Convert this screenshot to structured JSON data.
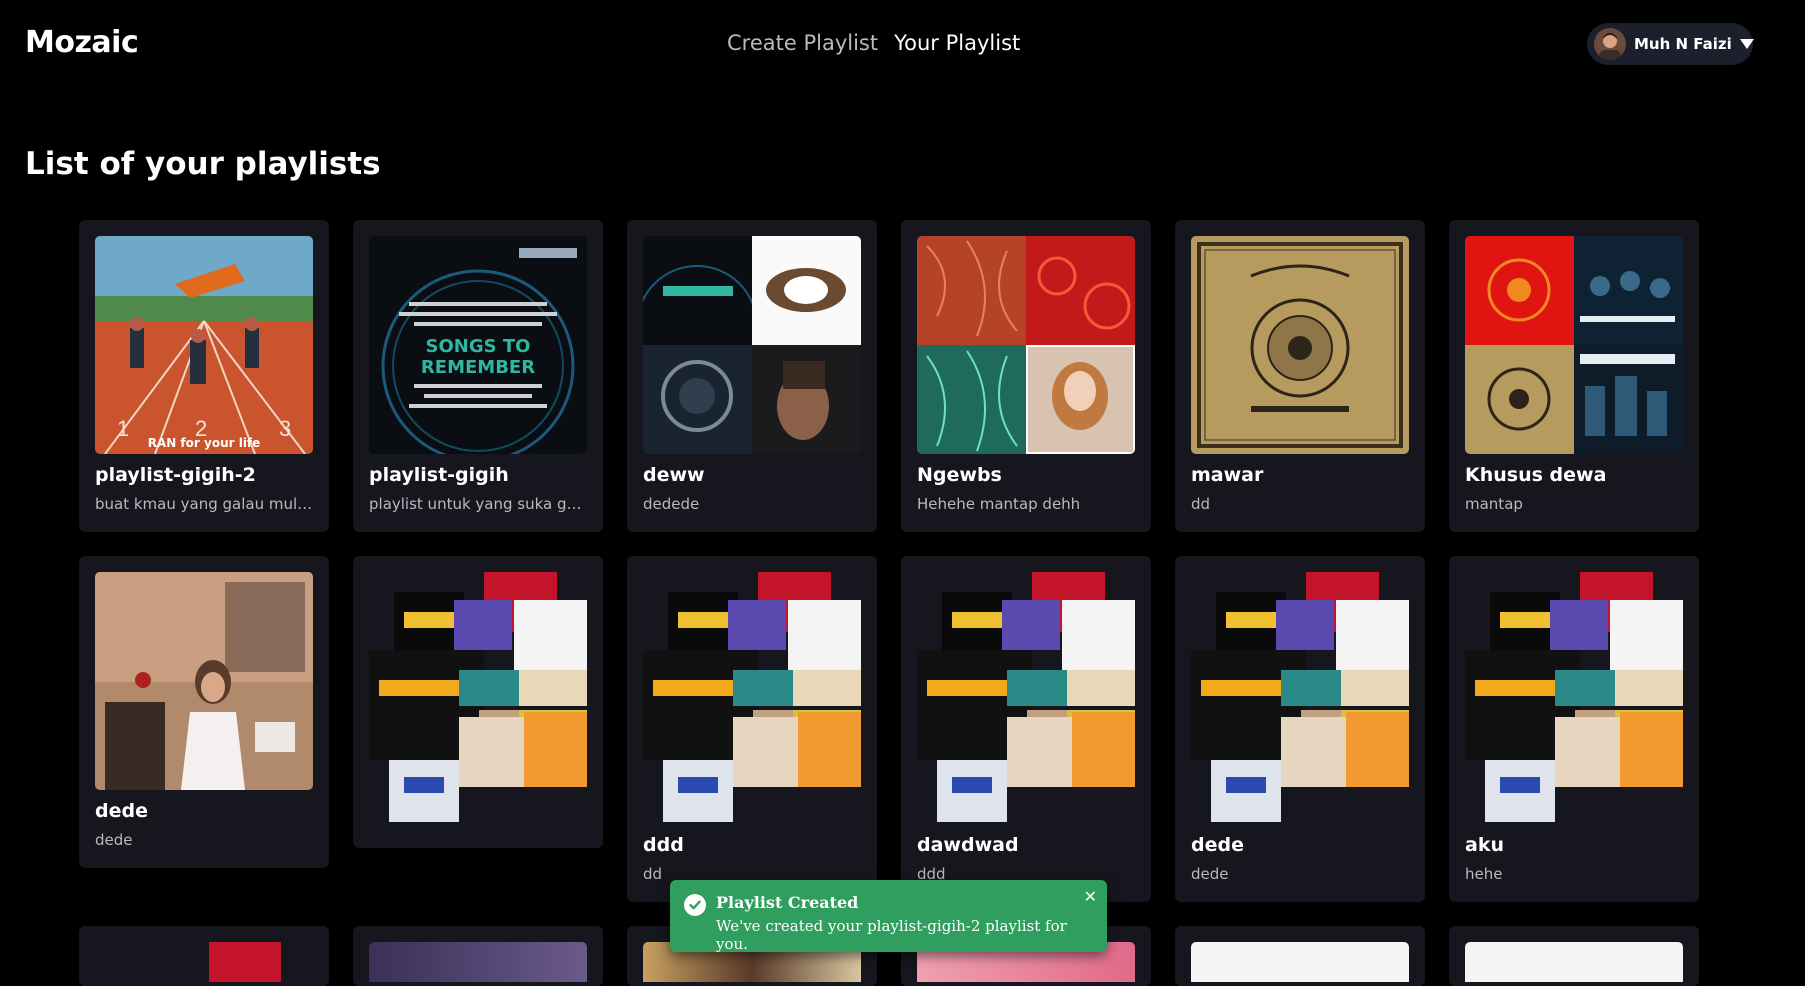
{
  "app": {
    "logo": "Mozaic"
  },
  "nav": {
    "create": "Create Playlist",
    "yours": "Your Playlist"
  },
  "user": {
    "name": "Muh N Faizi"
  },
  "page": {
    "title": "List of your playlists"
  },
  "playlists": [
    {
      "title": "playlist-gigih-2",
      "desc": "buat kmau yang galau mulu i...",
      "cover_caption": "RAN for your life"
    },
    {
      "title": "playlist-gigih",
      "desc": "playlist untuk yang suka galau",
      "cover_caption": "SONGS TO REMEMBER"
    },
    {
      "title": "deww",
      "desc": "dedede"
    },
    {
      "title": "Ngewbs",
      "desc": "Hehehe mantap dehh"
    },
    {
      "title": "mawar",
      "desc": "dd"
    },
    {
      "title": "Khusus dewa",
      "desc": "mantap"
    },
    {
      "title": "dede",
      "desc": "dede"
    },
    {
      "title": "",
      "desc": ""
    },
    {
      "title": "ddd",
      "desc": "dd"
    },
    {
      "title": "dawdwad",
      "desc": "ddd"
    },
    {
      "title": "dede",
      "desc": "dede"
    },
    {
      "title": "aku",
      "desc": "hehe"
    }
  ],
  "toast": {
    "title": "Playlist Created",
    "message": "We've created your playlist-gigih-2 playlist for you.",
    "color": "#2f9e5e"
  },
  "colors": {
    "background": "#000000",
    "card": "#16171e",
    "muted_text": "#b9b9c0"
  }
}
